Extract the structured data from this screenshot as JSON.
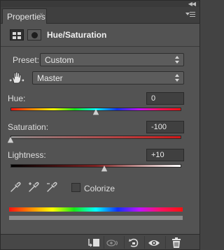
{
  "tab": {
    "title": "Properties",
    "close": "×"
  },
  "header": {
    "title": "Hue/Saturation",
    "icon_adjustment": "adjustment-layer-icon",
    "icon_mask": "mask-icon"
  },
  "preset": {
    "label": "Preset:",
    "value": "Custom"
  },
  "channel": {
    "value": "Master"
  },
  "hue": {
    "label": "Hue:",
    "value": "0",
    "level": 0.5
  },
  "saturation": {
    "label": "Saturation:",
    "value": "-100",
    "level": 0.0
  },
  "lightness": {
    "label": "Lightness:",
    "value": "+10",
    "level": 0.55
  },
  "colorize": {
    "label": "Colorize",
    "checked": false
  },
  "footer": {
    "icons": [
      "clip-to-layer-icon",
      "view-previous-state-icon",
      "reset-icon",
      "visibility-eye-icon",
      "trash-icon"
    ]
  }
}
